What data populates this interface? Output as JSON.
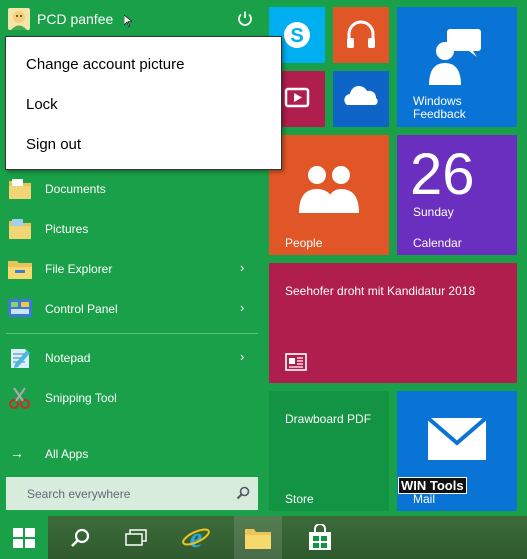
{
  "user": {
    "name": "PCD panfee"
  },
  "account_menu": [
    "Change account picture",
    "Lock",
    "Sign out"
  ],
  "left_items": [
    {
      "label": "Documents",
      "icon": "documents-folder-icon",
      "arrow": false
    },
    {
      "label": "Pictures",
      "icon": "pictures-folder-icon",
      "arrow": false
    },
    {
      "label": "File Explorer",
      "icon": "file-explorer-icon",
      "arrow": true
    },
    {
      "label": "Control Panel",
      "icon": "control-panel-icon",
      "arrow": true
    },
    {
      "label": "Notepad",
      "icon": "notepad-icon",
      "arrow": true
    },
    {
      "label": "Snipping Tool",
      "icon": "snipping-tool-icon",
      "arrow": false
    }
  ],
  "all_apps": "All Apps",
  "search_placeholder": "Search everywhere",
  "tiles": {
    "feedback": "Windows Feedback",
    "people": "People",
    "calendar_day": "26",
    "calendar_weekday": "Sunday",
    "calendar": "Calendar",
    "news": "Seehofer droht mit Kandidatur 2018",
    "drawboard": "Drawboard PDF",
    "store": "Store",
    "mail": "Mail"
  },
  "watermark": "WIN Tools",
  "colors": {
    "start_bg": "#1aa048",
    "skype": "#00aff0",
    "music": "#e15626",
    "video": "#b01e4d",
    "onedrive": "#0f64c8",
    "feedback": "#0a74d6",
    "people": "#e15626",
    "calendar": "#6b2fbf",
    "news": "#b01e4d",
    "store": "#129444",
    "mail": "#0a74d6"
  }
}
